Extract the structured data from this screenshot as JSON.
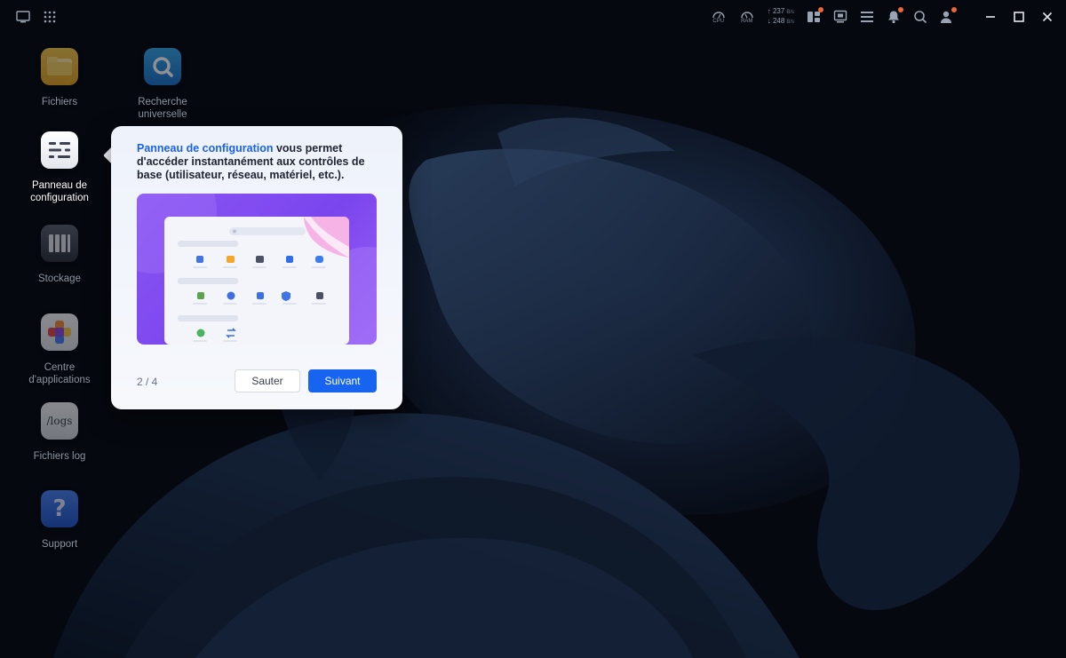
{
  "topbar": {
    "left_icons": [
      "show-desktop-icon",
      "app-grid-icon"
    ],
    "cpu_label": "CPU",
    "ram_label": "RAM",
    "upload": "237",
    "download": "248",
    "net_unit": "B/s",
    "right_icons": [
      "widgets-icon",
      "monitor-icon",
      "task-list-icon",
      "bell-icon",
      "search-icon",
      "user-icon"
    ],
    "window_controls": [
      "minimize-icon",
      "maximize-icon",
      "close-icon"
    ],
    "badge_color": "#e8683a"
  },
  "desktop": {
    "icons": [
      {
        "label": "Fichiers",
        "icon": "folder-icon"
      },
      {
        "label": "Recherche universelle",
        "icon": "universal-search-icon"
      },
      {
        "label": "Panneau de configuration",
        "icon": "control-panel-icon"
      },
      {
        "label": "Stockage",
        "icon": "storage-icon"
      },
      {
        "label": "Centre d'applications",
        "icon": "app-center-icon"
      },
      {
        "label": "Fichiers log",
        "icon": "logs-icon",
        "glyph": "/logs"
      },
      {
        "label": "Support",
        "icon": "support-icon",
        "glyph": "?"
      }
    ]
  },
  "tour": {
    "highlight": "Panneau de configuration",
    "message": " vous permet d'accéder instantanément aux contrôles de base (utilisateur, réseau, matériel, etc.).",
    "step": "2 / 4",
    "skip_label": "Sauter",
    "next_label": "Suivant",
    "accent": "#1764f0"
  }
}
